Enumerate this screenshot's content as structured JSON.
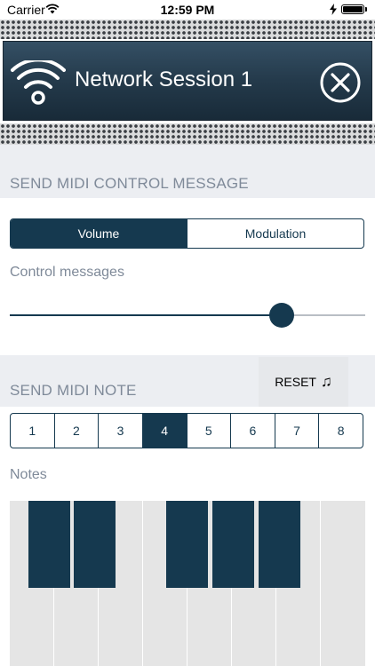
{
  "status_bar": {
    "carrier": "Carrier",
    "time": "12:59 PM"
  },
  "header": {
    "title": "Network Session 1",
    "icon": "wifi-icon",
    "close_icon": "close-icon"
  },
  "control_section": {
    "title": "SEND MIDI CONTROL MESSAGE",
    "tabs": [
      {
        "label": "Volume",
        "selected": true
      },
      {
        "label": "Modulation",
        "selected": false
      }
    ],
    "control_label": "Control messages",
    "slider_value": 0.77
  },
  "note_section": {
    "title": "SEND MIDI NOTE",
    "reset_label": "RESET",
    "reset_icon": "musical-note-icon",
    "octaves": [
      "1",
      "2",
      "3",
      "4",
      "5",
      "6",
      "7",
      "8"
    ],
    "selected_octave": "4",
    "notes_label": "Notes"
  },
  "colors": {
    "accent": "#15394f",
    "header_bg": "#243a4b",
    "section_bg": "#eceef2",
    "muted_text": "#7f8a99"
  }
}
